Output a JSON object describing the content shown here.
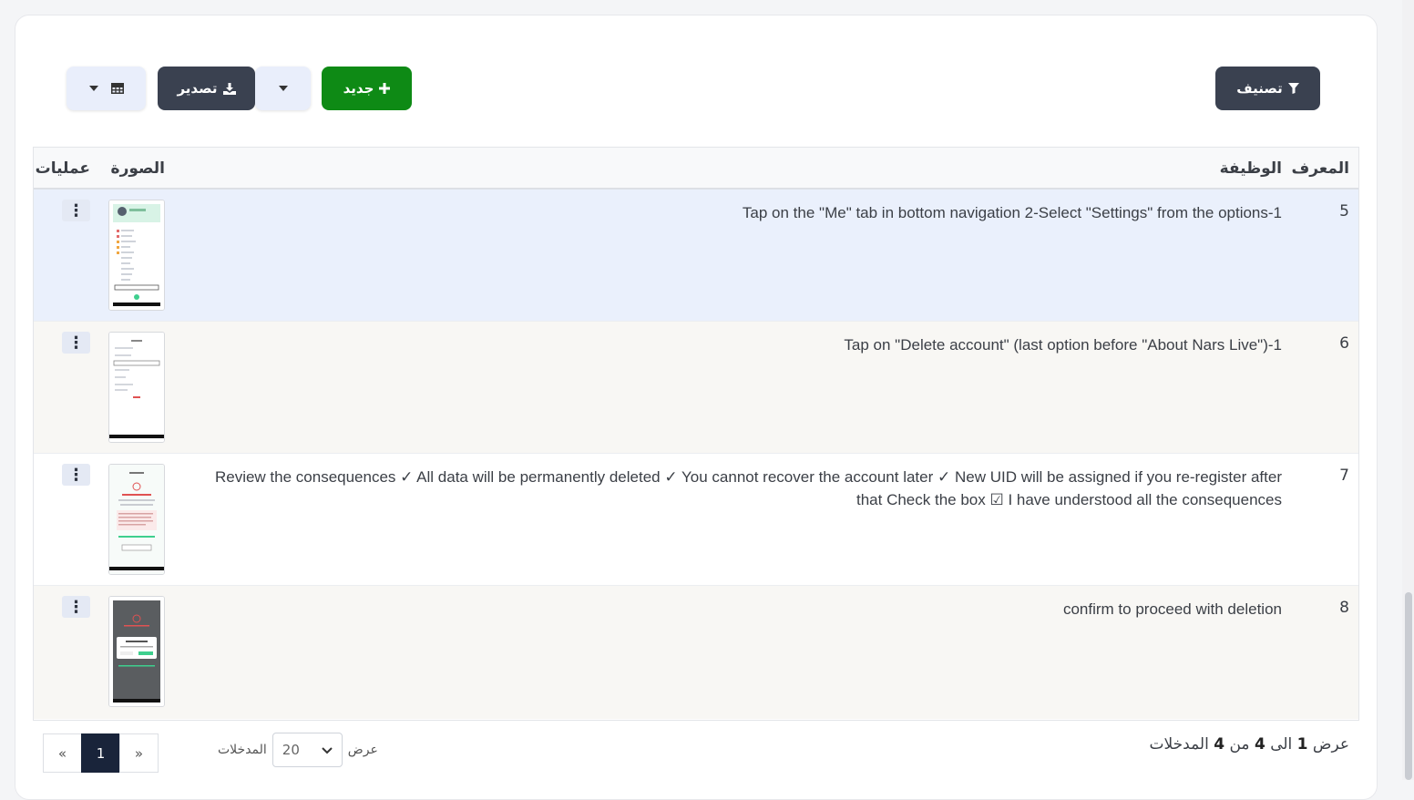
{
  "toolbar": {
    "filter_label": "تصنيف",
    "new_label": "جديد",
    "export_label": "تصدير"
  },
  "table": {
    "headers": {
      "id": "المعرف",
      "function": "الوظيفة",
      "image": "الصورة",
      "operations": "عمليات"
    },
    "rows": [
      {
        "id": "5",
        "text": "Tap on the \"Me\" tab in bottom navigation 2-Select \"Settings\" from the options-1",
        "ops": "⋮"
      },
      {
        "id": "6",
        "text": "Tap on \"Delete account\" (last option before \"About Nars Live\")-1",
        "ops": "⋮"
      },
      {
        "id": "7",
        "text": "Review the consequences ✓ All data will be permanently deleted ✓ You cannot recover the account later ✓ New UID will be assigned if you re-register after that Check the box ☑ I have understood all the consequences",
        "ops": "⋮"
      },
      {
        "id": "8",
        "text": "confirm to proceed with deletion",
        "ops": "⋮"
      }
    ]
  },
  "footer": {
    "info_prefix": "عرض",
    "info_from": "1",
    "info_to_word": "الى",
    "info_to": "4",
    "info_of_word": "من",
    "info_total": "4",
    "info_suffix": "المدخلات",
    "length_show": "عرض",
    "length_value": "20",
    "length_entries": "المدخلات",
    "pager_prev": "«",
    "pager_current": "1",
    "pager_next": "»"
  },
  "colors": {
    "accent_green": "#0e8a15",
    "dark_button": "#3a4150",
    "selected_row": "#eaf0fc",
    "active_page": "#19243a"
  }
}
